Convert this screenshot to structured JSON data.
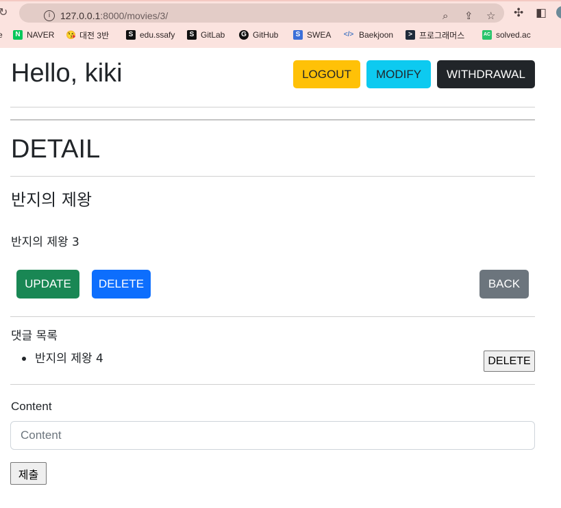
{
  "browser": {
    "url_host": "127.0.0.1",
    "url_path": ":8000/movies/3/",
    "bookmarks": [
      {
        "label": "e",
        "icon": ""
      },
      {
        "label": "NAVER",
        "icon": "N"
      },
      {
        "label": "대전 3반",
        "icon": "😘"
      },
      {
        "label": "edu.ssafy",
        "icon": "S"
      },
      {
        "label": "GitLab",
        "icon": "S"
      },
      {
        "label": "GitHub",
        "icon": "G"
      },
      {
        "label": "SWEA",
        "icon": "S"
      },
      {
        "label": "Baekjoon",
        "icon": "</>"
      },
      {
        "label": "프로그래머스",
        "icon": ">"
      },
      {
        "label": "solved.ac",
        "icon": "AC"
      }
    ]
  },
  "header": {
    "greeting": "Hello, kiki",
    "logout_label": "LOGOUT",
    "modify_label": "MODIFY",
    "withdrawal_label": "WITHDRAWAL"
  },
  "detail": {
    "heading": "DETAIL",
    "movie_title": "반지의 제왕",
    "movie_content": "반지의 제왕 3",
    "update_label": "UPDATE",
    "delete_label": "DELETE",
    "back_label": "BACK"
  },
  "comments": {
    "title": "댓글 목록",
    "items": [
      {
        "text": "반지의 제왕 4",
        "delete_label": "DELETE"
      }
    ]
  },
  "comment_form": {
    "label": "Content",
    "placeholder": "Content",
    "value": "",
    "submit_label": "제출"
  },
  "colors": {
    "warning": "#ffc107",
    "info": "#0dcaf0",
    "dark": "#212529",
    "success": "#198754",
    "primary": "#0d6efd",
    "secondary": "#6c757d"
  }
}
